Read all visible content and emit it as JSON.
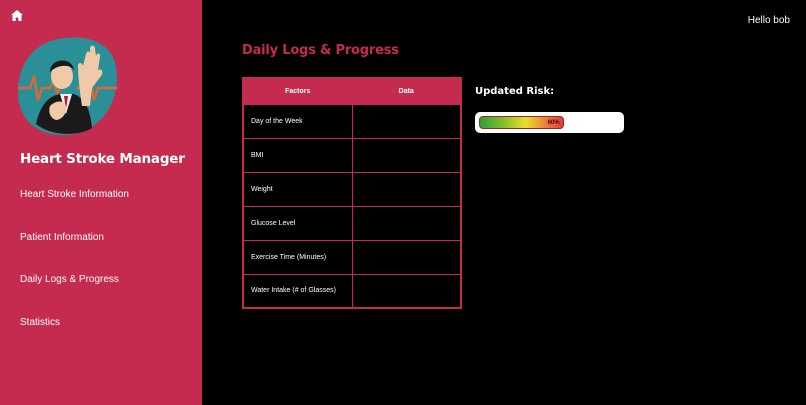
{
  "sidebar": {
    "title": "Heart Stroke Manager",
    "items": [
      {
        "label": "Heart Stroke Information"
      },
      {
        "label": "Patient Information"
      },
      {
        "label": "Daily Logs & Progress"
      },
      {
        "label": "Statistics"
      }
    ]
  },
  "header": {
    "greeting": "Hello bob"
  },
  "main": {
    "title": "Daily Logs & Progress",
    "table": {
      "headers": [
        "Factors",
        "Data"
      ],
      "rows": [
        {
          "factor": "Day of the Week",
          "data": ""
        },
        {
          "factor": "BMI",
          "data": ""
        },
        {
          "factor": "Weight",
          "data": ""
        },
        {
          "factor": "Glucose Level",
          "data": ""
        },
        {
          "factor": "Exercise Time (Minutes)",
          "data": ""
        },
        {
          "factor": "Water Intake (# of Glasses)",
          "data": ""
        }
      ]
    },
    "risk": {
      "title": "Updated Risk:",
      "label": "60%",
      "fraction": 0.6
    }
  },
  "colors": {
    "accent": "#c42b4e",
    "background": "#000000"
  },
  "icons": {
    "home": "home-icon"
  }
}
